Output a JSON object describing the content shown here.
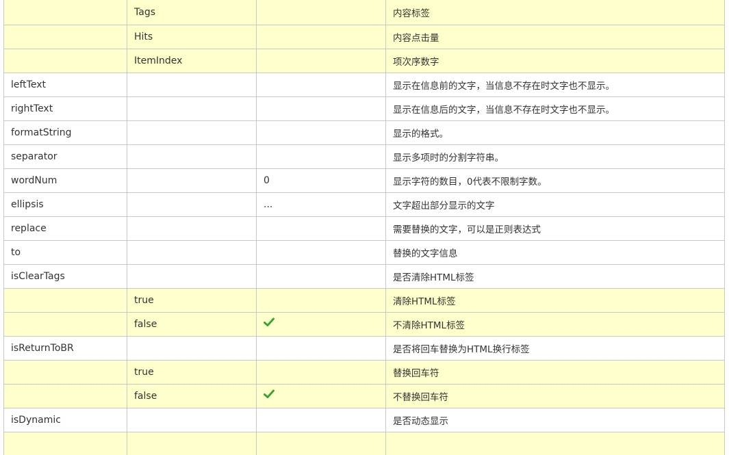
{
  "table": {
    "rows": [
      {
        "name": "",
        "value": "Tags",
        "default": "",
        "check": false,
        "desc": "内容标签",
        "sub": true
      },
      {
        "name": "",
        "value": "Hits",
        "default": "",
        "check": false,
        "desc": "内容点击量",
        "sub": true
      },
      {
        "name": "",
        "value": "ItemIndex",
        "default": "",
        "check": false,
        "desc": "项次序数字",
        "sub": true
      },
      {
        "name": "leftText",
        "value": "",
        "default": "",
        "check": false,
        "desc": "显示在信息前的文字，当信息不存在时文字也不显示。",
        "sub": false
      },
      {
        "name": "rightText",
        "value": "",
        "default": "",
        "check": false,
        "desc": "显示在信息后的文字，当信息不存在时文字也不显示。",
        "sub": false
      },
      {
        "name": "formatString",
        "value": "",
        "default": "",
        "check": false,
        "desc": "显示的格式。",
        "sub": false
      },
      {
        "name": "separator",
        "value": "",
        "default": "",
        "check": false,
        "desc": "显示多项时的分割字符串。",
        "sub": false
      },
      {
        "name": "wordNum",
        "value": "",
        "default": "0",
        "check": false,
        "desc": "显示字符的数目，0代表不限制字数。",
        "sub": false
      },
      {
        "name": "ellipsis",
        "value": "",
        "default": "...",
        "check": false,
        "desc": "文字超出部分显示的文字",
        "sub": false
      },
      {
        "name": "replace",
        "value": "",
        "default": "",
        "check": false,
        "desc": "需要替换的文字，可以是正则表达式",
        "sub": false
      },
      {
        "name": "to",
        "value": "",
        "default": "",
        "check": false,
        "desc": "替换的文字信息",
        "sub": false
      },
      {
        "name": "isClearTags",
        "value": "",
        "default": "",
        "check": false,
        "desc": "是否清除HTML标签",
        "sub": false
      },
      {
        "name": "",
        "value": "true",
        "default": "",
        "check": false,
        "desc": "清除HTML标签",
        "sub": true
      },
      {
        "name": "",
        "value": "false",
        "default": "",
        "check": true,
        "desc": "不清除HTML标签",
        "sub": true
      },
      {
        "name": "isReturnToBR",
        "value": "",
        "default": "",
        "check": false,
        "desc": "是否将回车替换为HTML换行标签",
        "sub": false
      },
      {
        "name": "",
        "value": "true",
        "default": "",
        "check": false,
        "desc": "替换回车符",
        "sub": true
      },
      {
        "name": "",
        "value": "false",
        "default": "",
        "check": true,
        "desc": "不替换回车符",
        "sub": true
      },
      {
        "name": "isDynamic",
        "value": "",
        "default": "",
        "check": false,
        "desc": "是否动态显示",
        "sub": false
      },
      {
        "name": "",
        "value": "",
        "default": "",
        "check": false,
        "desc": "",
        "sub": true
      }
    ],
    "check_color": "#3aa335",
    "sub_row_color": "#ffffcc"
  }
}
